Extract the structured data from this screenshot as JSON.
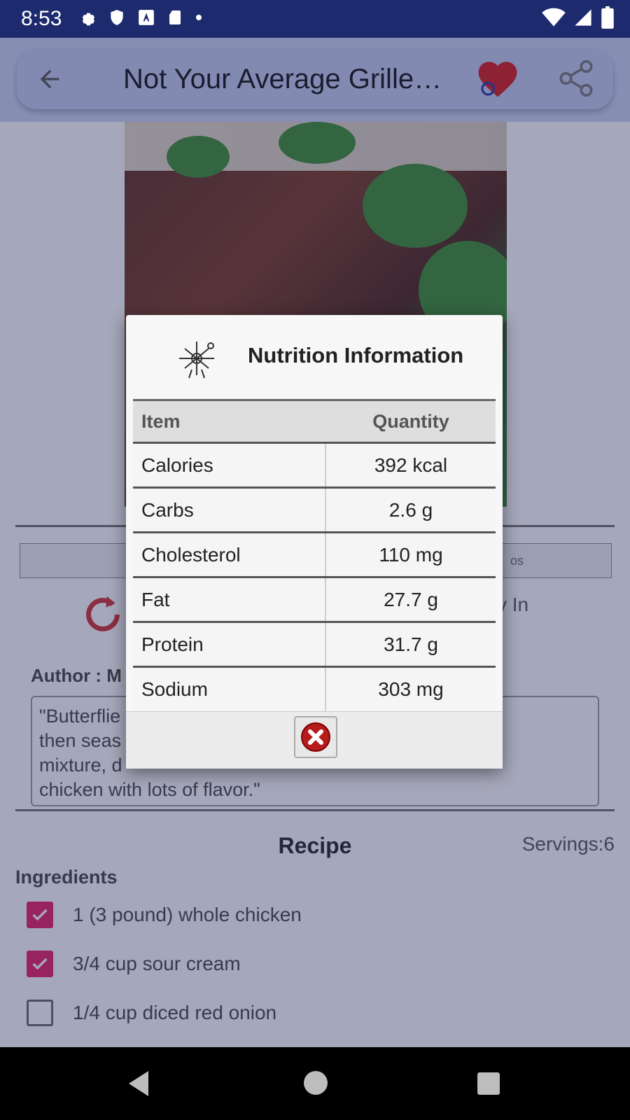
{
  "status_bar": {
    "time": "8:53",
    "left_icons": [
      "gear-icon",
      "shield-icon",
      "a-badge-icon",
      "sd-card-icon",
      "dot-icon"
    ],
    "right_icons": [
      "wifi-icon",
      "signal-icon",
      "battery-icon"
    ]
  },
  "app_bar": {
    "title": "Not Your Average Grilled Chicken",
    "back_icon": "arrow-left-icon",
    "favorite_icon": "heart-icon",
    "share_icon": "share-icon",
    "favorite_color": "#d81b1b"
  },
  "background": {
    "tab_text": "os",
    "side_text": "y In",
    "author_label": "Author : M",
    "description": "\"Butterflie                                         en,\nthen seas                                              m-herb\nmixture,                                                 d\nchicken with lots of flavor.\"",
    "recipe_title": "Recipe",
    "servings": "Servings:6",
    "ingredients_label": "Ingredients",
    "ingredients": [
      {
        "text": "1 (3 pound) whole chicken",
        "checked": true
      },
      {
        "text": "3/4 cup sour cream",
        "checked": true
      },
      {
        "text": "1/4 cup diced red onion",
        "checked": false
      }
    ],
    "accent_color": "#e91e63"
  },
  "dialog": {
    "title": "Nutrition Information",
    "logo_icon": "logo-icon",
    "columns": [
      "Item",
      "Quantity"
    ],
    "rows": [
      {
        "item": "Calories",
        "quantity": "392 kcal"
      },
      {
        "item": "Carbs",
        "quantity": "2.6 g"
      },
      {
        "item": "Cholesterol",
        "quantity": "110 mg"
      },
      {
        "item": "Fat",
        "quantity": "27.7 g"
      },
      {
        "item": "Protein",
        "quantity": "31.7 g"
      },
      {
        "item": "Sodium",
        "quantity": "303 mg"
      }
    ],
    "close_icon": "close-x-icon",
    "close_color": "#b71c1c"
  },
  "nav_bar": {
    "back_icon": "nav-back-icon",
    "home_icon": "nav-home-icon",
    "recents_icon": "nav-recents-icon"
  }
}
